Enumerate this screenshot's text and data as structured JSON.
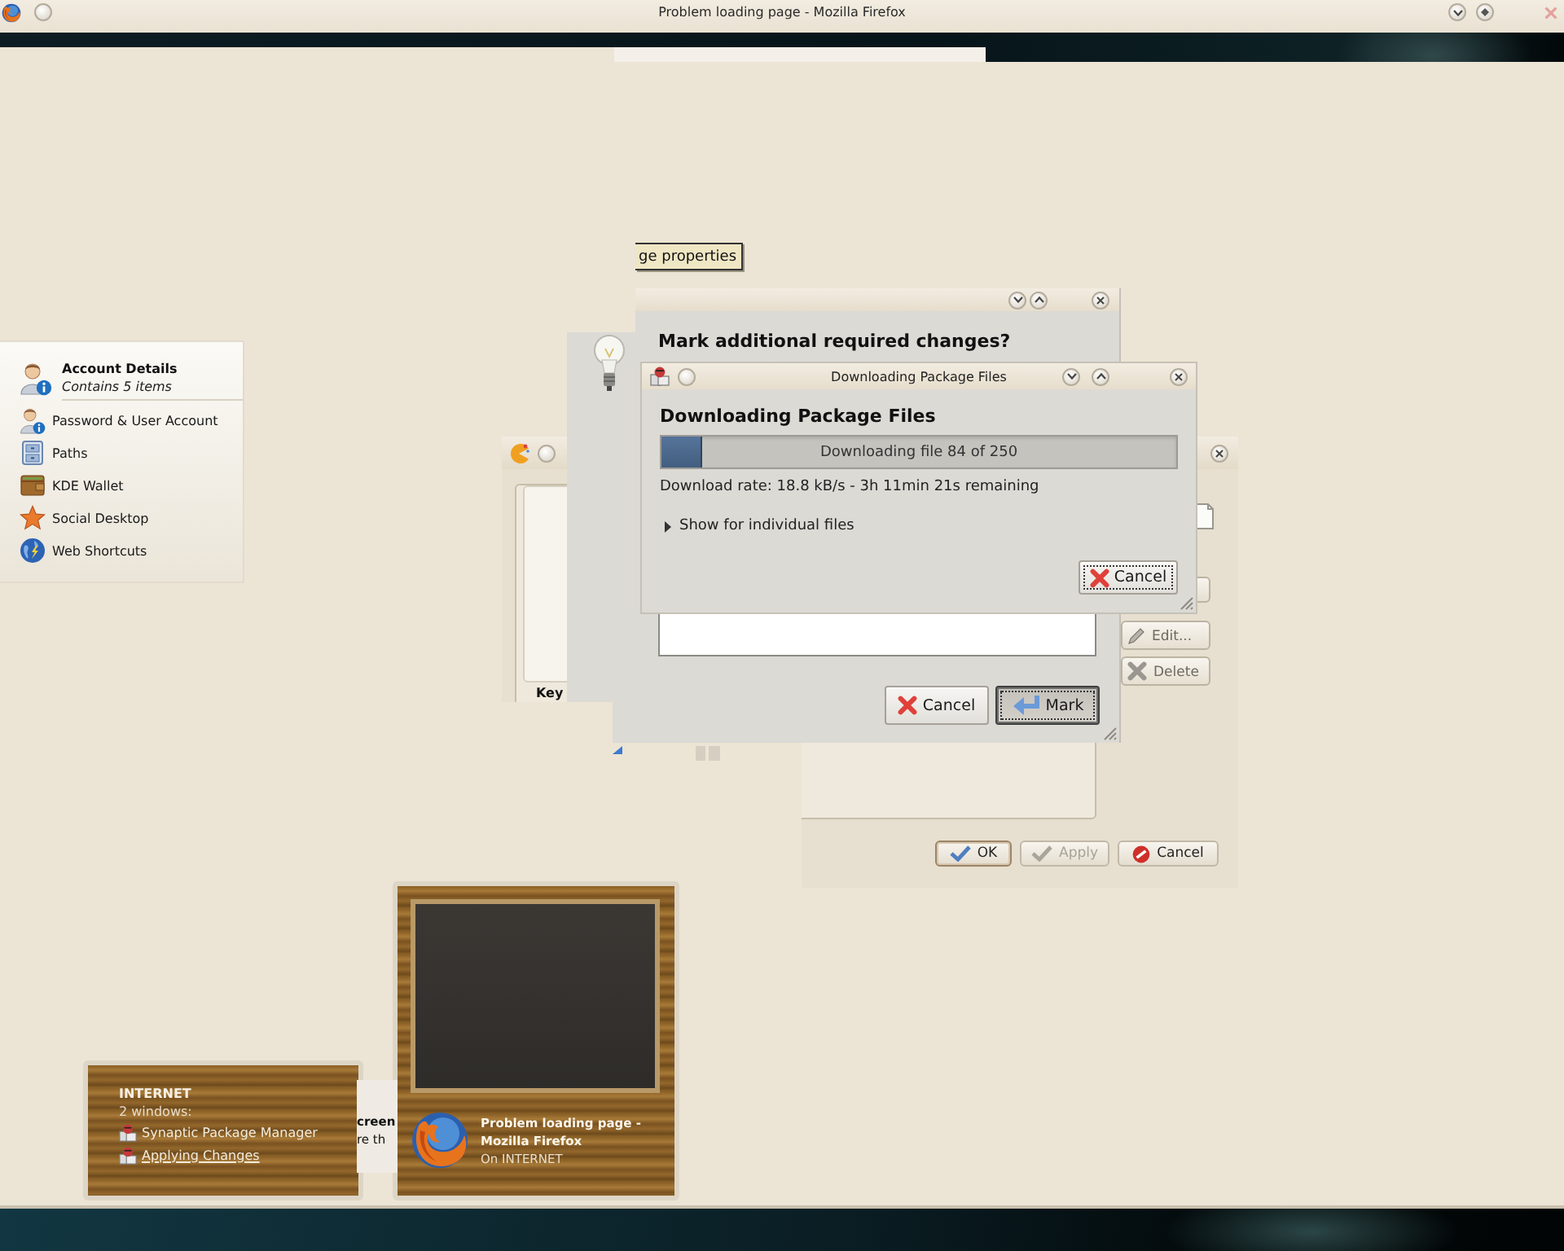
{
  "title_bar": {
    "title": "Problem loading page - Mozilla Firefox"
  },
  "tooltip": {
    "text": "ge properties"
  },
  "account_panel": {
    "title": "Account Details",
    "subtitle": "Contains 5 items",
    "items": [
      {
        "label": "Password & User Account"
      },
      {
        "label": "Paths"
      },
      {
        "label": "KDE Wallet"
      },
      {
        "label": "Social Desktop"
      },
      {
        "label": "Web Shortcuts"
      }
    ]
  },
  "settings_window": {
    "list_label": "Key",
    "side_buttons": [
      {
        "label": "Edit..."
      },
      {
        "label": "Delete"
      }
    ],
    "buttons": [
      {
        "label": "OK",
        "kind": "ok",
        "disabled": false,
        "default": true
      },
      {
        "label": "Apply",
        "kind": "apply",
        "disabled": true,
        "default": false
      },
      {
        "label": "Cancel",
        "kind": "cancel",
        "disabled": false,
        "default": false
      }
    ]
  },
  "mark_dialog": {
    "heading": "Mark additional required changes?",
    "buttons": [
      {
        "label": "Cancel",
        "kind": "cancel",
        "default": false,
        "focused": false
      },
      {
        "label": "Mark",
        "kind": "mark",
        "default": true,
        "focused": true
      }
    ]
  },
  "download_dialog": {
    "title": "Downloading Package Files",
    "heading": "Downloading Package Files",
    "progress": {
      "level": 0.08,
      "text": "Downloading file 84 of 250"
    },
    "rate": "Download rate: 18.8 kB/s - 3h 11min 21s remaining",
    "expander": {
      "label": "Show for individual files",
      "expanded": false
    },
    "cancel": {
      "label": "Cancel",
      "focused": true
    }
  },
  "notification_fragment": {
    "lines": [
      {
        "text": "creen",
        "kind": "title"
      },
      {
        "text": "re th",
        "kind": "body"
      }
    ]
  },
  "task_group": {
    "name": "INTERNET",
    "count": "2 windows:",
    "windows": [
      {
        "title": "Synaptic Package Manager",
        "selected": false
      },
      {
        "title": "Applying Changes",
        "selected": true
      }
    ]
  },
  "window_preview": {
    "title_lines": [
      "Problem loading page -",
      "Mozilla Firefox"
    ],
    "desktop": "On INTERNET"
  }
}
